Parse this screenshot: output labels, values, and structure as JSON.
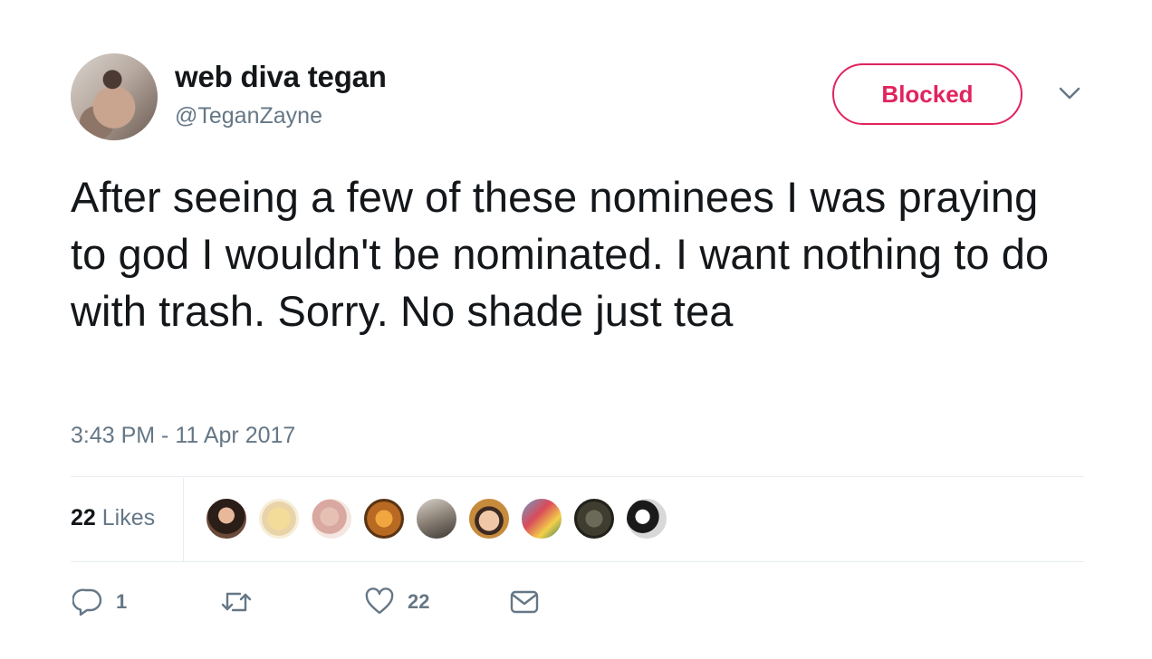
{
  "user": {
    "display_name": "web diva tegan",
    "handle": "@TeganZayne",
    "avatar_icon": "profile-photo"
  },
  "follow_state": {
    "label": "Blocked",
    "color": "#e0245e"
  },
  "tweet": {
    "text": "After seeing a few of these nominees I was praying to god I wouldn't be nominated. I want nothing to do with trash. Sorry. No shade just tea",
    "timestamp": "3:43 PM - 11 Apr 2017"
  },
  "likes": {
    "count": "22",
    "label": "Likes"
  },
  "actions": {
    "reply_count": "1",
    "retweet_count": "",
    "like_count": "22"
  },
  "colors": {
    "accent": "#e0245e",
    "secondary_text": "#657786",
    "divider": "#e6ecf0"
  }
}
